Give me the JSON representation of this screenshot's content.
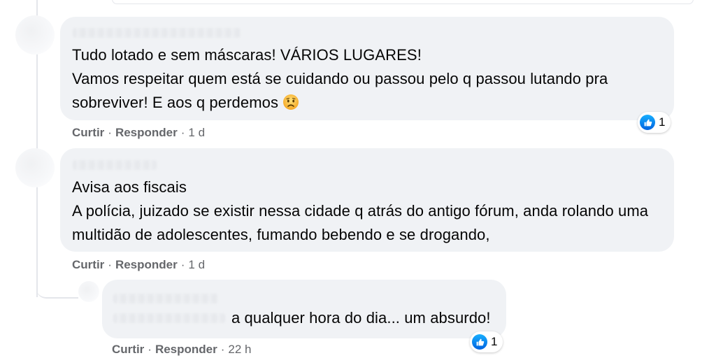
{
  "comments": [
    {
      "lines": [
        "Tudo lotado e sem máscaras! VÁRIOS LUGARES!",
        "Vamos respeitar quem está se cuidando ou passou pelo q passou lutando pra",
        "sobreviver! E aos q perdemos"
      ],
      "emoji": "sad-face-emoji",
      "like_label": "Curtir",
      "reply_label": "Responder",
      "time": "1 d",
      "reaction_count": "1"
    },
    {
      "lines": [
        "Avisa aos fiscais",
        "A polícia, juizado se existir nessa cidade q atrás do antigo fórum, anda rolando uma",
        "multidão de adolescentes, fumando bebendo e se drogando,"
      ],
      "like_label": "Curtir",
      "reply_label": "Responder",
      "time": "1 d"
    }
  ],
  "reply": {
    "text": "a qualquer hora do dia... um absurdo!",
    "like_label": "Curtir",
    "reply_label": "Responder",
    "time": "22 h",
    "reaction_count": "1"
  },
  "separator": "·",
  "colors": {
    "bubble": "#f0f2f5",
    "meta_text": "#65676b",
    "like_blue": "#1877f2"
  }
}
